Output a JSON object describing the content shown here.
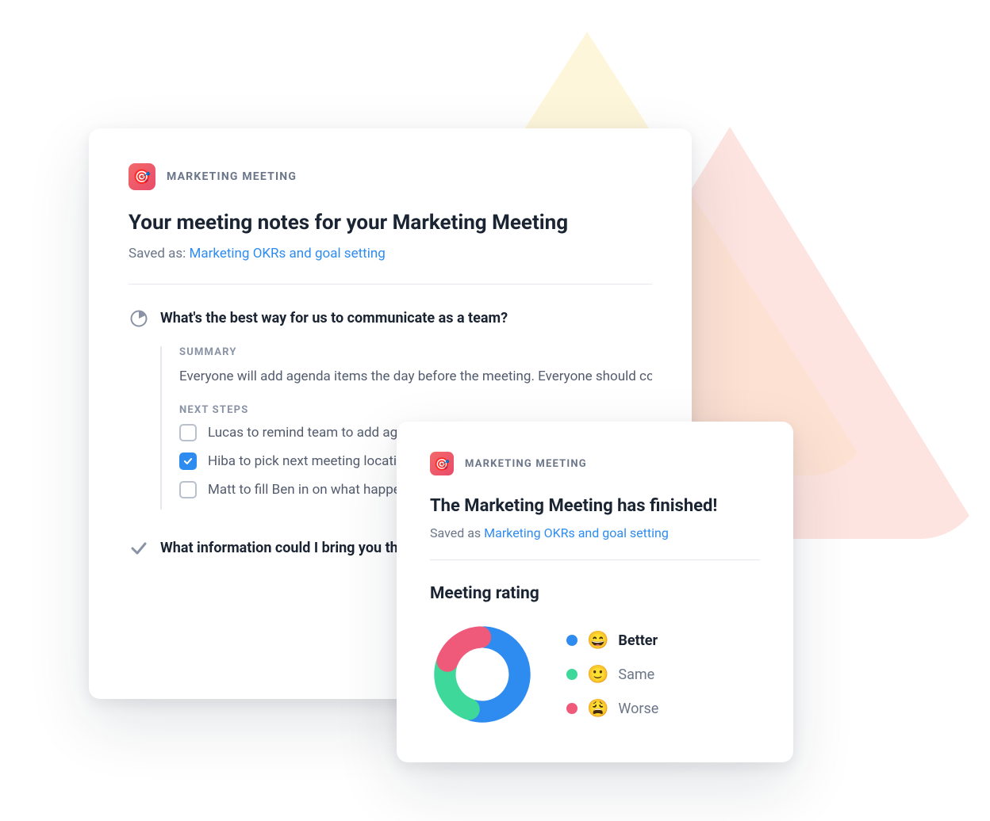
{
  "notes_card": {
    "app_label": "MARKETING MEETING",
    "app_icon_emoji": "🎯",
    "title": "Your meeting notes for your Marketing Meeting",
    "saved_prefix": "Saved as: ",
    "saved_link_text": "Marketing OKRs and goal setting",
    "topic1": {
      "title": "What's the best way for us to communicate as a team?",
      "summary_label": "SUMMARY",
      "summary_text": "Everyone will add agenda items the day before the meeting. Everyone should come prepared having read agenda items.",
      "next_steps_label": "NEXT STEPS",
      "steps": [
        {
          "label": "Lucas to remind team to add agenda items",
          "checked": false
        },
        {
          "label": "Hiba to pick next meeting location",
          "checked": true
        },
        {
          "label": "Matt to fill Ben in on what happened",
          "checked": false
        }
      ]
    },
    "topic2": {
      "title": "What information could I bring you that would help?"
    }
  },
  "rating_card": {
    "app_label": "MARKETING MEETING",
    "app_icon_emoji": "🎯",
    "title": "The Marketing Meeting has finished!",
    "saved_prefix": "Saved as ",
    "saved_link_text": "Marketing OKRs and goal setting",
    "section_title": "Meeting rating",
    "legend": [
      {
        "label": "Better",
        "emoji": "😄",
        "color": "#2E8CF0"
      },
      {
        "label": "Same",
        "emoji": "🙂",
        "color": "#3ED89A"
      },
      {
        "label": "Worse",
        "emoji": "😩",
        "color": "#F05A7A"
      }
    ]
  },
  "chart_data": {
    "type": "pie",
    "title": "Meeting rating",
    "series": [
      {
        "name": "Better",
        "value": 55,
        "color": "#2E8CF0"
      },
      {
        "name": "Same",
        "value": 25,
        "color": "#3ED89A"
      },
      {
        "name": "Worse",
        "value": 20,
        "color": "#F05A7A"
      }
    ],
    "donut_inner_ratio": 0.55
  }
}
